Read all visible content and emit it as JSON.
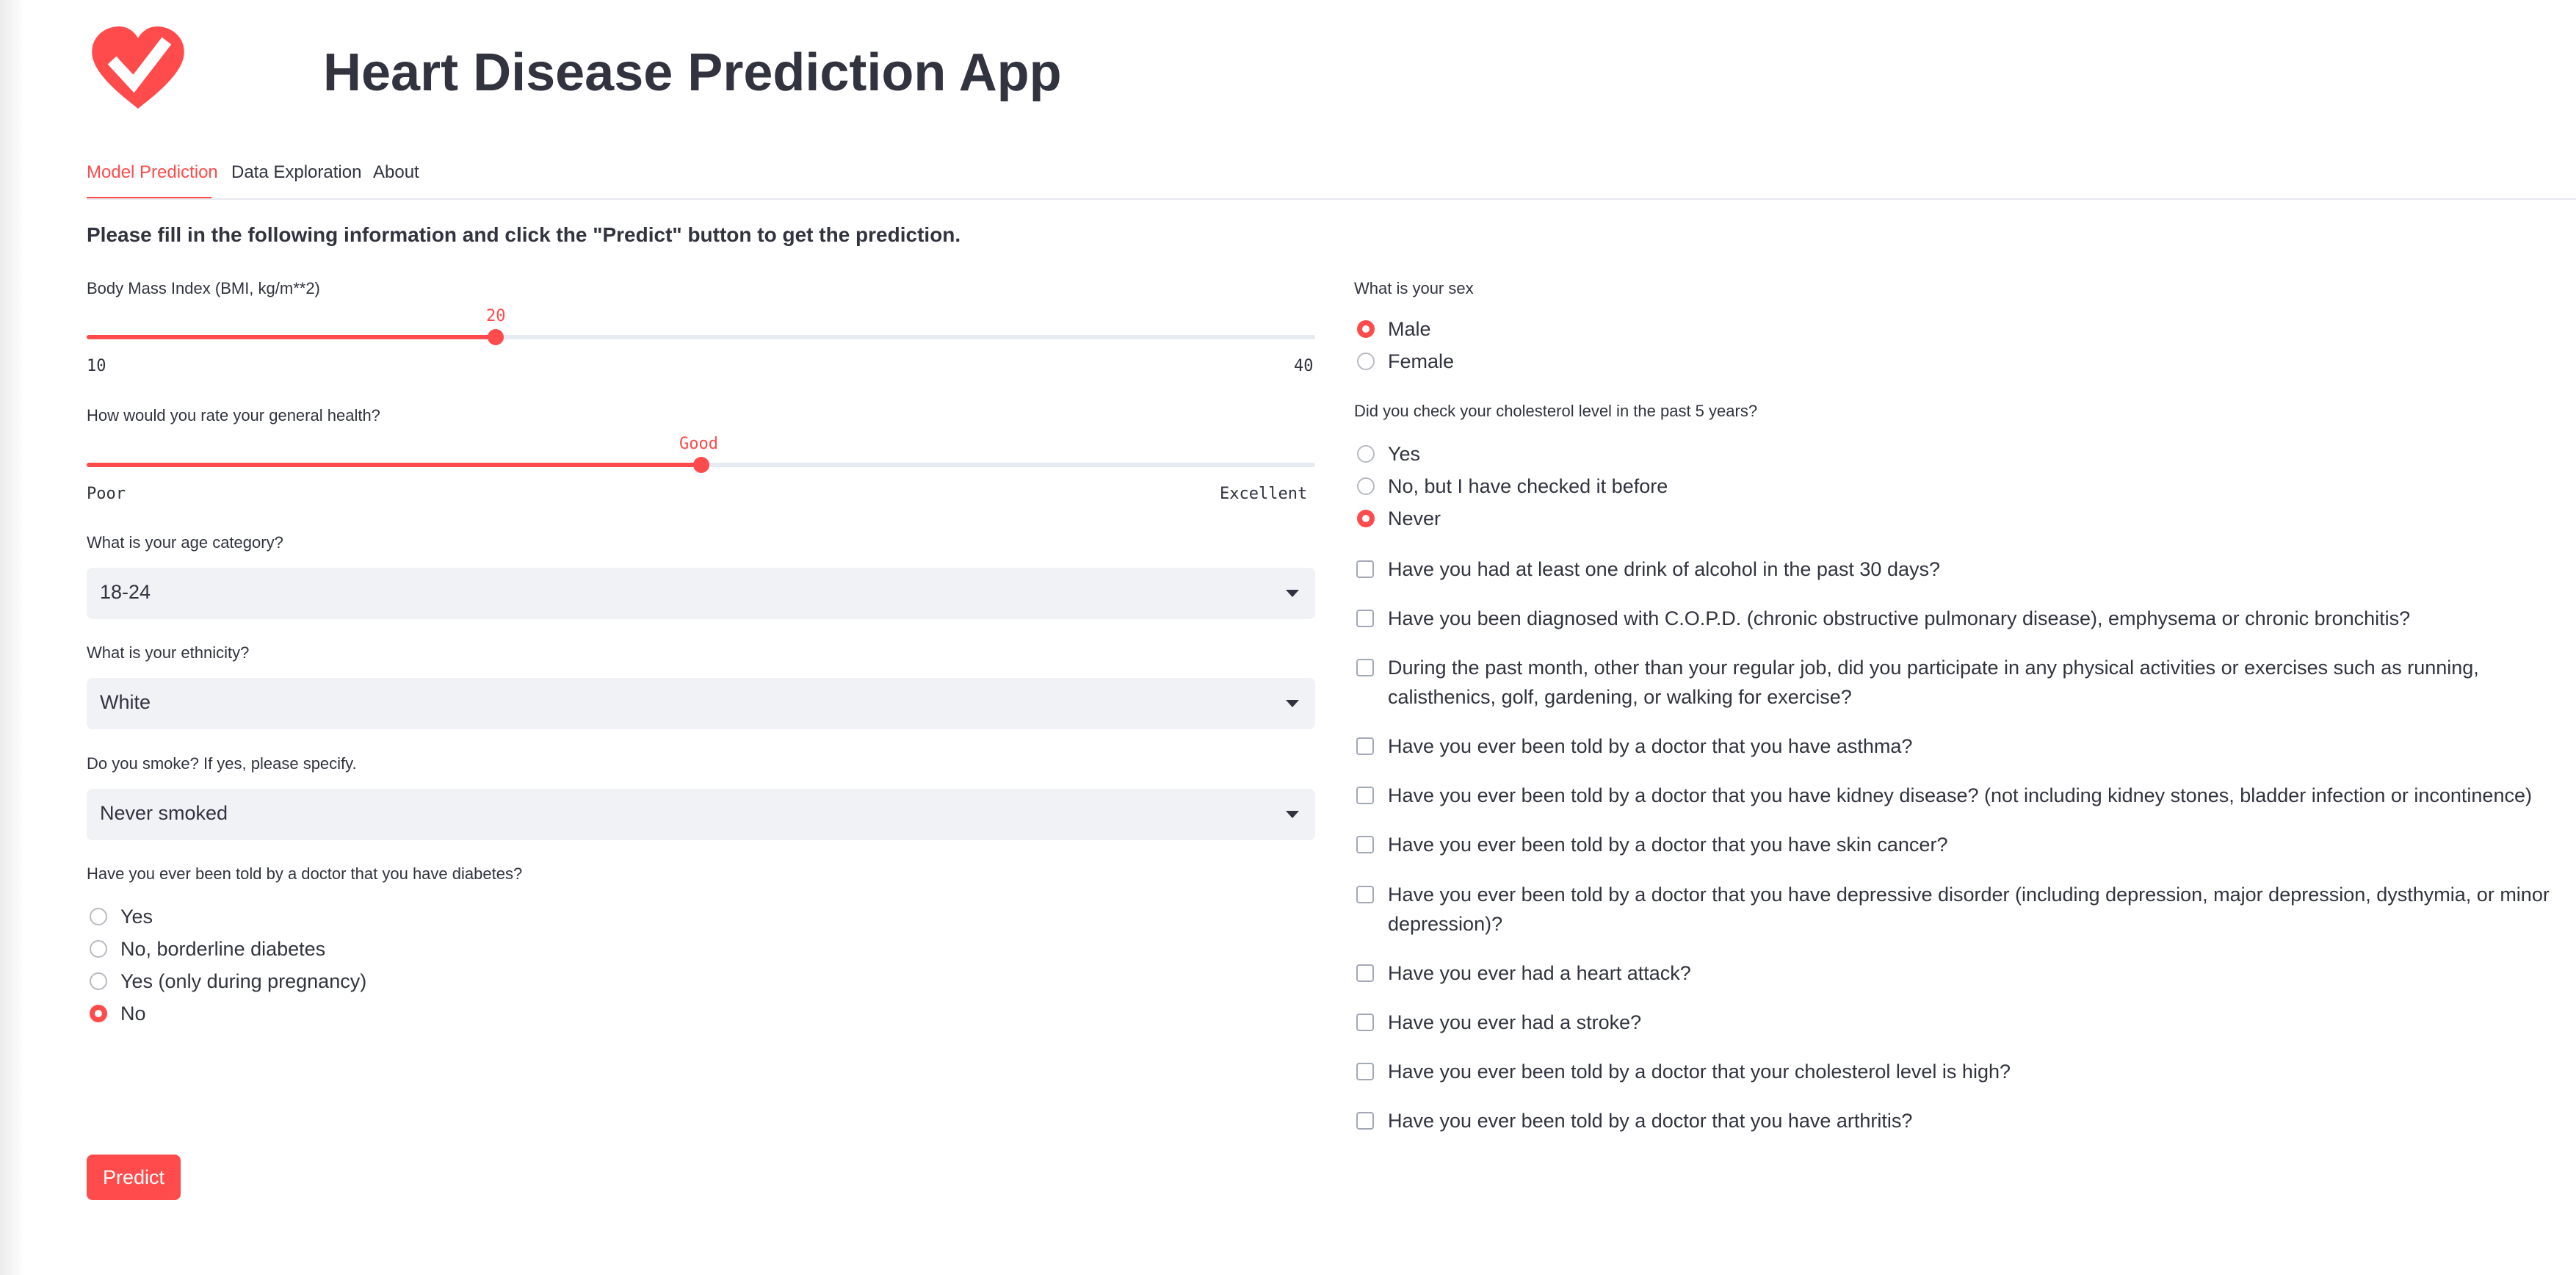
{
  "app": {
    "title": "Heart Disease Prediction App",
    "logo_icon": "heart-check-icon",
    "accent_color": "#ff4b4b"
  },
  "tabs": [
    {
      "label": "Model Prediction",
      "active": true
    },
    {
      "label": "Data Exploration",
      "active": false
    },
    {
      "label": "About",
      "active": false
    }
  ],
  "instructions": "Please fill in the following information and click the \"Predict\" button to get the prediction.",
  "bmi": {
    "label": "Body Mass Index (BMI, kg/m**2)",
    "value": "20",
    "min": "10",
    "max": "40",
    "fill_fraction": 0.333
  },
  "health": {
    "label": "How would you rate your general health?",
    "value": "Good",
    "min_label": "Poor",
    "max_label": "Excellent",
    "fill_fraction": 0.5
  },
  "age": {
    "label": "What is your age category?",
    "value": "18-24"
  },
  "ethnicity": {
    "label": "What is your ethnicity?",
    "value": "White"
  },
  "smoke": {
    "label": "Do you smoke? If yes, please specify.",
    "value": "Never smoked"
  },
  "diabetes": {
    "label": "Have you ever been told by a doctor that you have diabetes?",
    "options": [
      "Yes",
      "No, borderline diabetes",
      "Yes (only during pregnancy)",
      "No"
    ],
    "selected": "No"
  },
  "sex": {
    "label": "What is your sex",
    "options": [
      "Male",
      "Female"
    ],
    "selected": "Male"
  },
  "cholesterol_check": {
    "label": "Did you check your cholesterol level in the past 5 years?",
    "options": [
      "Yes",
      "No, but I have checked it before",
      "Never"
    ],
    "selected": "Never"
  },
  "checkboxes": [
    {
      "label": "Have you had at least one drink of alcohol in the past 30 days?",
      "checked": false
    },
    {
      "label": "Have you been diagnosed with C.O.P.D. (chronic obstructive pulmonary disease), emphysema or chronic bronchitis?",
      "checked": false
    },
    {
      "label": "During the past month, other than your regular job, did you participate in any physical activities or exercises such as running, calisthenics, golf, gardening, or walking for exercise?",
      "checked": false
    },
    {
      "label": "Have you ever been told by a doctor that you have asthma?",
      "checked": false
    },
    {
      "label": "Have you ever been told by a doctor that you have kidney disease? (not including kidney stones, bladder infection or incontinence)",
      "checked": false
    },
    {
      "label": "Have you ever been told by a doctor that you have skin cancer?",
      "checked": false
    },
    {
      "label": "Have you ever been told by a doctor that you have depressive disorder (including depression, major depression, dysthymia, or minor depression)?",
      "checked": false
    },
    {
      "label": "Have you ever had a heart attack?",
      "checked": false
    },
    {
      "label": "Have you ever had a stroke?",
      "checked": false
    },
    {
      "label": "Have you ever been told by a doctor that your cholesterol level is high?",
      "checked": false
    },
    {
      "label": "Have you ever been told by a doctor that you have arthritis?",
      "checked": false
    }
  ],
  "predict_button": "Predict"
}
